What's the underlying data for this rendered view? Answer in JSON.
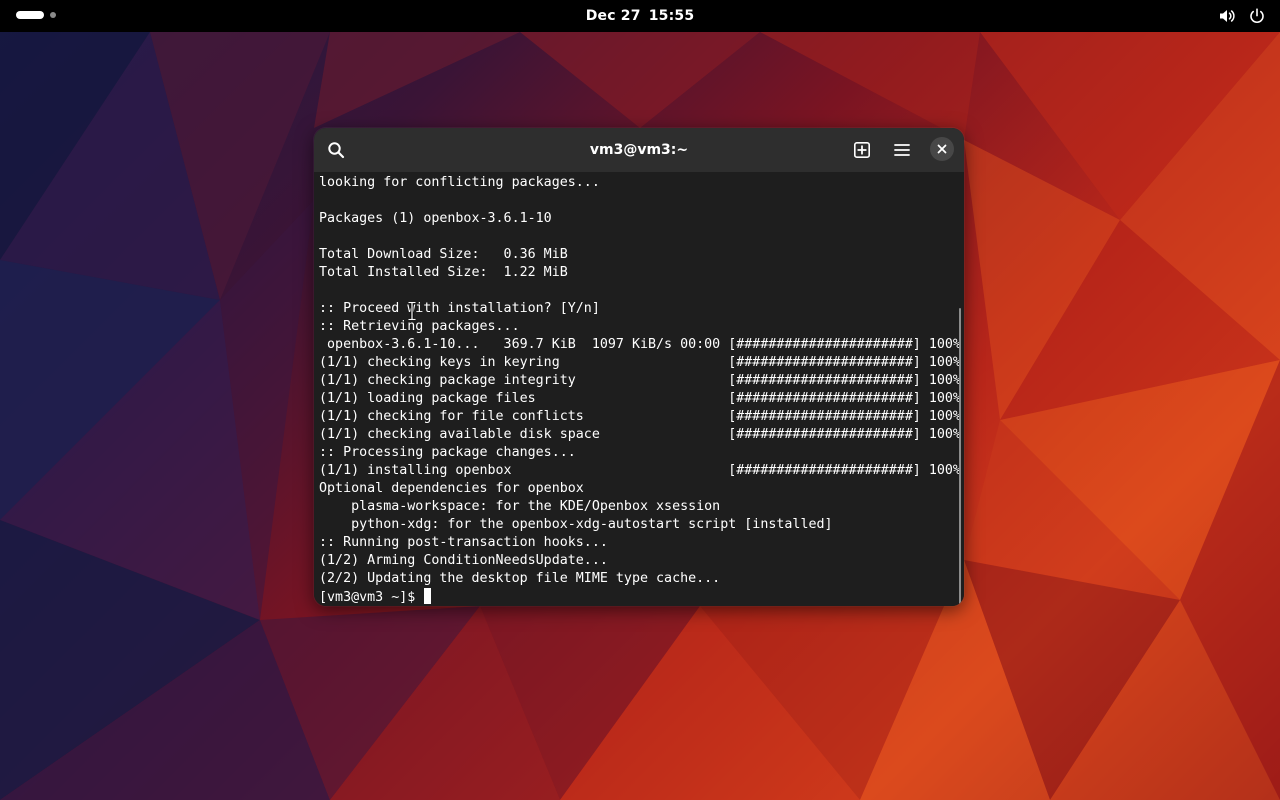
{
  "topbar": {
    "date": "Dec 27",
    "time": "15:55"
  },
  "window": {
    "title": "vm3@vm3:~"
  },
  "terminal": {
    "lines": [
      "looking for conflicting packages...",
      "",
      "Packages (1) openbox-3.6.1-10",
      "",
      "Total Download Size:   0.36 MiB",
      "Total Installed Size:  1.22 MiB",
      "",
      ":: Proceed with installation? [Y/n]",
      ":: Retrieving packages...",
      " openbox-3.6.1-10...   369.7 KiB  1097 KiB/s 00:00 [######################] 100%",
      "(1/1) checking keys in keyring                     [######################] 100%",
      "(1/1) checking package integrity                   [######################] 100%",
      "(1/1) loading package files                        [######################] 100%",
      "(1/1) checking for file conflicts                  [######################] 100%",
      "(1/1) checking available disk space                [######################] 100%",
      ":: Processing package changes...",
      "(1/1) installing openbox                           [######################] 100%",
      "Optional dependencies for openbox",
      "    plasma-workspace: for the KDE/Openbox xsession",
      "    python-xdg: for the openbox-xdg-autostart script [installed]",
      ":: Running post-transaction hooks...",
      "(1/2) Arming ConditionNeedsUpdate...",
      "(2/2) Updating the desktop file MIME type cache..."
    ],
    "prompt": "[vm3@vm3 ~]$ "
  },
  "icons": {
    "search": "search-icon",
    "new_tab": "new-tab-icon",
    "menu": "hamburger-menu-icon",
    "close": "close-icon",
    "volume": "volume-icon",
    "power": "power-icon"
  },
  "colors": {
    "topbar_bg": "#000000",
    "headerbar_bg": "#2e2e2e",
    "terminal_bg": "#1e1e1e",
    "terminal_fg": "#ffffff"
  }
}
